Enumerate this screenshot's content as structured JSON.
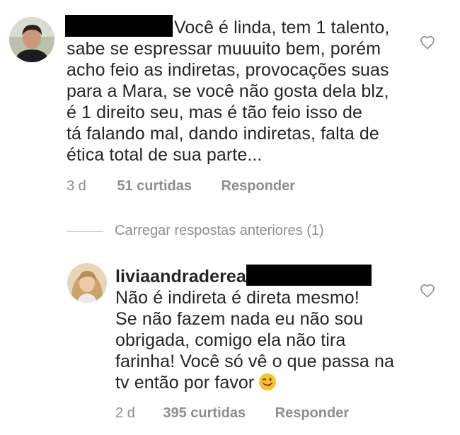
{
  "comment1": {
    "text_lines": [
      "Você é linda, tem 1 talento,",
      "sabe se espressar muuuito bem, porém",
      "acho feio as indiretas, provocações suas",
      "para a Mara, se você não gosta dela blz,",
      "é 1 direito seu, mas é tão feio isso de",
      "tá falando mal, dando indiretas, falta de",
      "ética total de sua parte..."
    ],
    "time": "3 d",
    "likes": "51 curtidas",
    "reply_label": "Responder",
    "icons": {
      "avatar": "user-avatar",
      "like": "heart-outline-icon"
    }
  },
  "load_more": {
    "label": "Carregar respostas anteriores (1)"
  },
  "comment2": {
    "username": "liviaandradereal",
    "text_lines": [
      "Não é indireta é direta mesmo!",
      "Se não fazem nada eu não sou",
      "obrigada, comigo ela não tira",
      "farinha! Você só vê o que passa na",
      "tv então por favor"
    ],
    "time": "2 d",
    "likes": "395 curtidas",
    "reply_label": "Responder",
    "icons": {
      "avatar": "user-avatar",
      "like": "heart-outline-icon",
      "emoji": "winking-face-with-tongue-emoji"
    }
  },
  "colors": {
    "text": "#262626",
    "meta": "#8e8e8e",
    "divider": "#c7c7c7",
    "redaction": "#000000"
  }
}
